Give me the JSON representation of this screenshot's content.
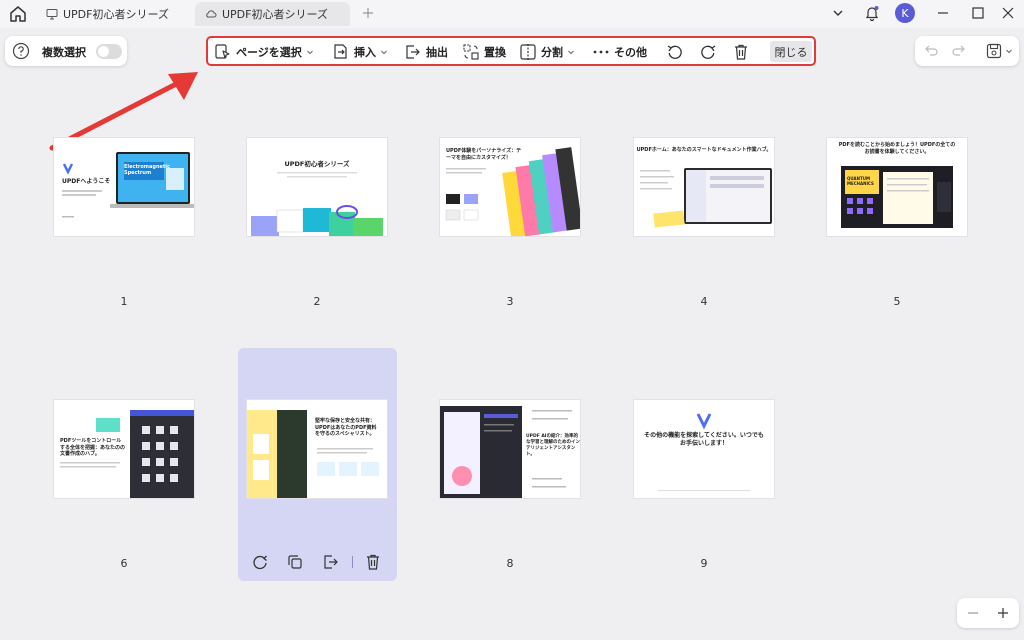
{
  "window": {
    "tabs": [
      {
        "label": "UPDF初心者シリーズ"
      },
      {
        "label": "UPDF初心者シリーズ"
      }
    ],
    "avatar_letter": "K"
  },
  "left_panel": {
    "multi_select_label": "複数選択"
  },
  "toolbar": {
    "select_pages": "ページを選択",
    "insert": "挿入",
    "extract": "抽出",
    "replace": "置換",
    "split": "分割",
    "more": "その他",
    "close": "閉じる"
  },
  "pages": [
    {
      "number": "1",
      "title": "UPDFへようこそ",
      "subtitle": "Electromagnetic Spectrum"
    },
    {
      "number": "2",
      "title": "UPDF初心者シリーズ"
    },
    {
      "number": "3",
      "title": "UPDF体験をパーソナライズ：テーマを自由にカスタマイズ！"
    },
    {
      "number": "4",
      "title": "UPDFホーム：あなたのスマートなドキュメント作業ハブ。"
    },
    {
      "number": "5",
      "title": "PDFを読むことから始めましょう！UPDFの全てのお読書を体験してください。",
      "subtitle": "QUANTUM MECHANICS"
    },
    {
      "number": "6",
      "title": "PDFツールをコントロールする全体を把握：あなたのの文書作成のハブ。"
    },
    {
      "number": "7",
      "title": "堅牢な保存と安全な共有：UPDFはあなたのPDF資料を守るのスペシャリスト。"
    },
    {
      "number": "8",
      "title": "UPDF AIの紹介：効率的な学習と理解のためのインテリジェントアシスタント。"
    },
    {
      "number": "9",
      "title": "その他の機能を探索してください。いつでもお手伝いします！"
    }
  ]
}
